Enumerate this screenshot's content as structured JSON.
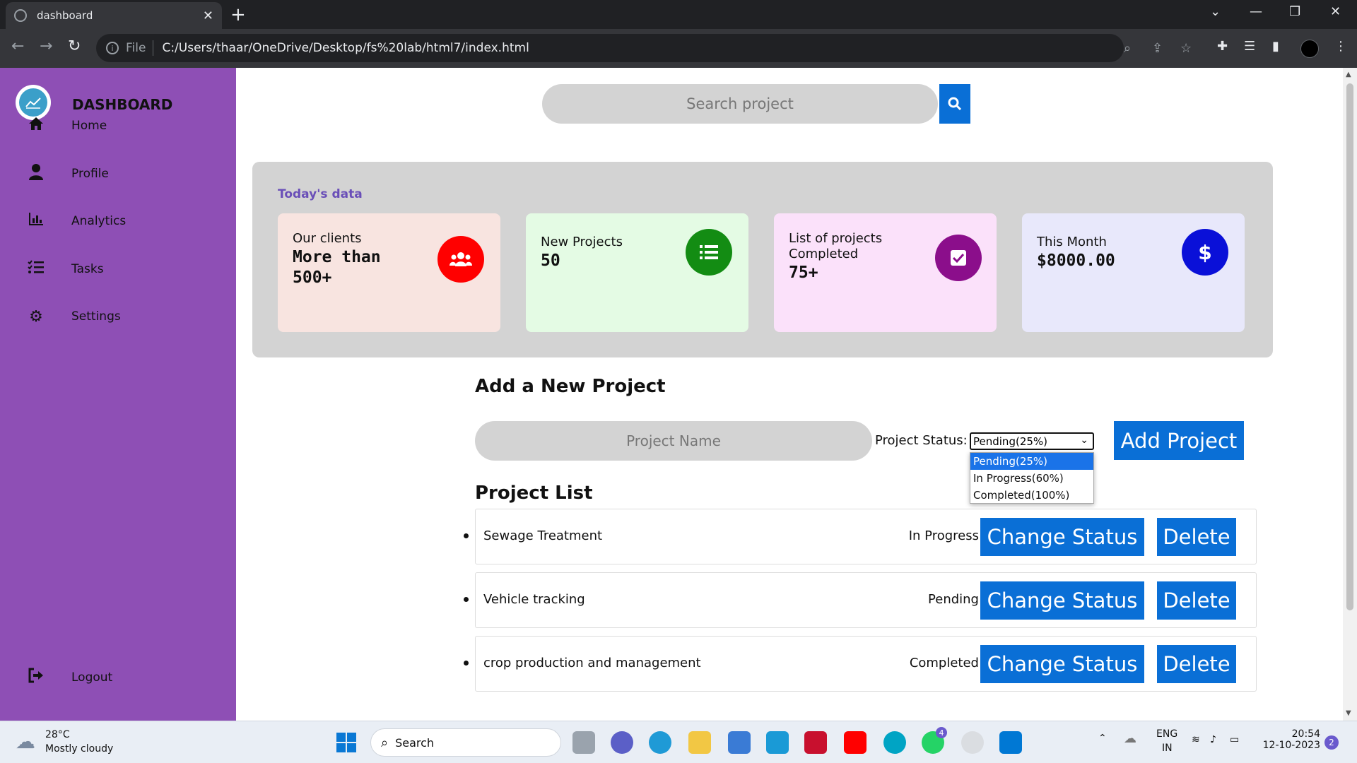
{
  "browser": {
    "tab_title": "dashboard",
    "url_scheme": "File",
    "url": "C:/Users/thaar/OneDrive/Desktop/fs%20lab/html7/index.html"
  },
  "sidebar": {
    "brand": "DASHBOARD",
    "items": [
      {
        "label": "Home",
        "icon": "home-icon"
      },
      {
        "label": "Profile",
        "icon": "user-icon"
      },
      {
        "label": "Analytics",
        "icon": "chart-icon"
      },
      {
        "label": "Tasks",
        "icon": "tasks-icon"
      },
      {
        "label": "Settings",
        "icon": "gear-icon"
      }
    ],
    "logout": "Logout"
  },
  "search": {
    "placeholder": "Search project"
  },
  "today": {
    "label": "Today's data",
    "cards": [
      {
        "title": "Our clients",
        "value": "More than 500+",
        "bg": "#f8e4e0",
        "icon_bg": "#ff0000",
        "icon": "users-icon"
      },
      {
        "title": "New Projects",
        "value": "50",
        "bg": "#e4fbe4",
        "icon_bg": "#138c13",
        "icon": "list-icon"
      },
      {
        "title": "List of projects Completed",
        "value": "75+",
        "bg": "#fbe1fa",
        "icon_bg": "#8b0e8b",
        "icon": "checkbox-icon"
      },
      {
        "title": "This Month",
        "value": "$8000.00",
        "bg": "#e8e8fb",
        "icon_bg": "#0a10d8",
        "icon": "dollar-icon"
      }
    ]
  },
  "add_project": {
    "title": "Add a New Project",
    "name_placeholder": "Project Name",
    "status_label": "Project Status:",
    "selected_status": "Pending(25%)",
    "status_options": [
      "Pending(25%)",
      "In Progress(60%)",
      "Completed(100%)"
    ],
    "add_button": "Add Project"
  },
  "project_list": {
    "title": "Project List",
    "change_button": "Change Status",
    "delete_button": "Delete",
    "items": [
      {
        "name": "Sewage Treatment",
        "status": "In Progress"
      },
      {
        "name": "Vehicle tracking",
        "status": "Pending"
      },
      {
        "name": "crop production and management",
        "status": "Completed"
      }
    ]
  },
  "taskbar": {
    "temperature": "28°C",
    "weather": "Mostly cloudy",
    "search": "Search",
    "lang_top": "ENG",
    "lang_bottom": "IN",
    "time": "20:54",
    "date": "12-10-2023",
    "notification_count": "2",
    "whatsapp_badge": "4"
  }
}
